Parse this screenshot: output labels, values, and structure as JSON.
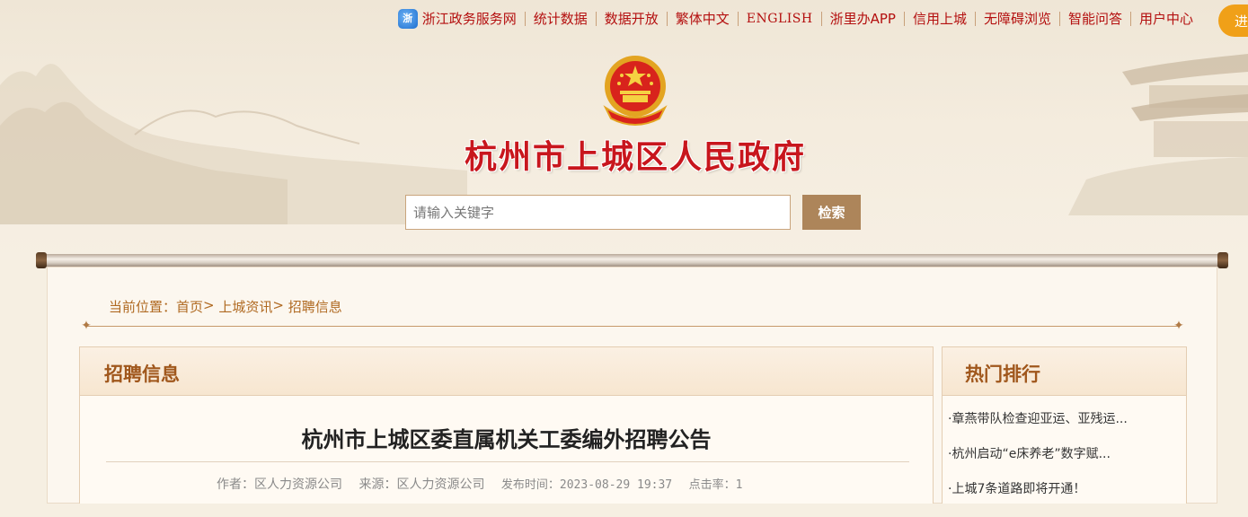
{
  "top_nav": {
    "items": [
      {
        "label": "浙江政务服务网",
        "icon": "zhejiang-gov-logo-icon"
      },
      {
        "label": "统计数据"
      },
      {
        "label": "数据开放"
      },
      {
        "label": "繁体中文"
      },
      {
        "label": "ENGLISH"
      },
      {
        "label": "浙里办APP"
      },
      {
        "label": "信用上城"
      },
      {
        "label": "无障碍浏览"
      },
      {
        "label": "智能问答"
      },
      {
        "label": "用户中心"
      }
    ],
    "login_label": "进"
  },
  "header": {
    "site_title": "杭州市上城区人民政府",
    "emblem_icon": "national-emblem-icon"
  },
  "search": {
    "placeholder": "请输入关键字",
    "button_label": "检索"
  },
  "breadcrumb": {
    "prefix": "当前位置：",
    "items": [
      "首页",
      "上城资讯",
      "招聘信息"
    ],
    "separator": ">"
  },
  "main": {
    "section_title": "招聘信息",
    "article": {
      "title": "杭州市上城区委直属机关工委编外招聘公告",
      "author": "作者：区人力资源公司",
      "source": "来源：区人力资源公司",
      "publish_time": "发布时间：2023-08-29 19:37",
      "clicks": "点击率：1"
    }
  },
  "sidebar": {
    "title": "热门排行",
    "items": [
      "·章燕带队检查迎亚运、亚残运...",
      "·杭州启动“e床养老”数字赋...",
      "·上城7条道路即将开通！"
    ]
  },
  "colors": {
    "nav_text": "#b40f0f",
    "title_red": "#c8161d",
    "section_title": "#a0571c",
    "search_button": "#ad855a",
    "login_button": "#f0a018"
  }
}
